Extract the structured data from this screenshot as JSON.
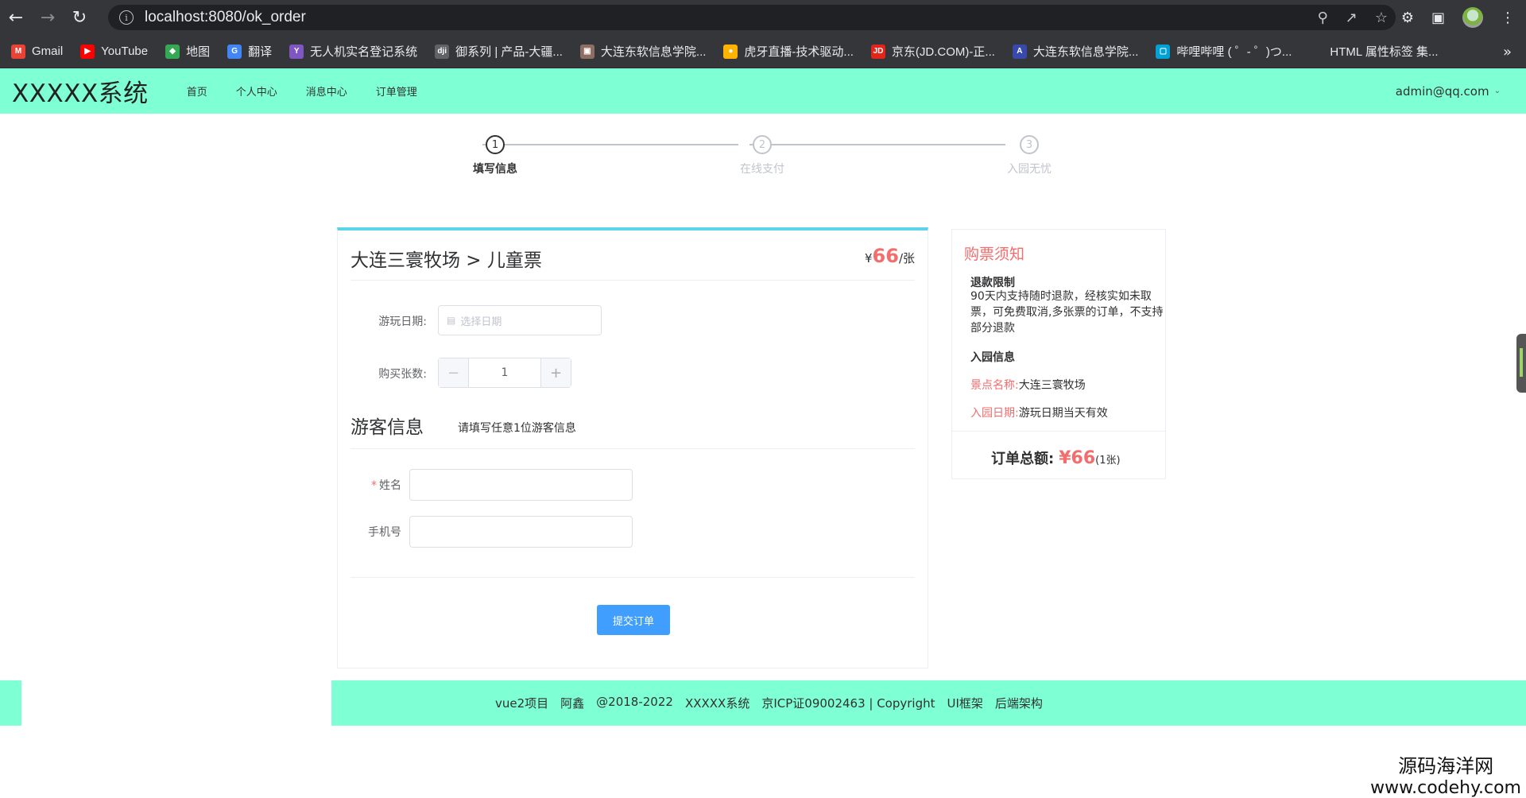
{
  "browser": {
    "url": "localhost:8080/ok_order",
    "bookmarks": [
      {
        "label": "Gmail",
        "icon": "gmail-icon",
        "color": "#ea4335",
        "glyph": "M"
      },
      {
        "label": "YouTube",
        "icon": "youtube-icon",
        "color": "#ff0000",
        "glyph": "▶"
      },
      {
        "label": "地图",
        "icon": "maps-icon",
        "color": "#34a853",
        "glyph": "◆"
      },
      {
        "label": "翻译",
        "icon": "translate-icon",
        "color": "#4285f4",
        "glyph": "G"
      },
      {
        "label": "无人机实名登记系统",
        "icon": "drone-icon",
        "color": "#7e57c2",
        "glyph": "Y"
      },
      {
        "label": "御系列 | 产品-大疆...",
        "icon": "dji-icon",
        "color": "#5f6368",
        "glyph": "dji"
      },
      {
        "label": "大连东软信息学院...",
        "icon": "school-icon",
        "color": "#8d6e63",
        "glyph": "▣"
      },
      {
        "label": "虎牙直播-技术驱动...",
        "icon": "huya-icon",
        "color": "#ffb300",
        "glyph": "●"
      },
      {
        "label": "京东(JD.COM)-正...",
        "icon": "jd-icon",
        "color": "#e1251b",
        "glyph": "JD"
      },
      {
        "label": "大连东软信息学院...",
        "icon": "school2-icon",
        "color": "#3949ab",
        "glyph": "A"
      },
      {
        "label": "哔哩哔哩 ( ゜- ゜)つ...",
        "icon": "bilibili-icon",
        "color": "#00a1d6",
        "glyph": "▢"
      },
      {
        "label": "HTML 属性标签 集...",
        "icon": "html-icon",
        "color": "#35363a",
        "glyph": ""
      }
    ],
    "more": "»"
  },
  "header": {
    "logo": "XXXXX系统",
    "menu": [
      "首页",
      "个人中心",
      "消息中心",
      "订单管理"
    ],
    "user": "admin@qq.com"
  },
  "steps": [
    {
      "num": "1",
      "label": "填写信息",
      "state": "active"
    },
    {
      "num": "2",
      "label": "在线支付",
      "state": "wait"
    },
    {
      "num": "3",
      "label": "入园无忧",
      "state": "wait"
    }
  ],
  "order": {
    "title": "大连三寰牧场 > 儿童票",
    "currency": "¥",
    "price": "66",
    "unit": "/张",
    "date_label": "游玩日期:",
    "date_placeholder": "选择日期",
    "qty_label": "购买张数:",
    "qty_value": "1",
    "qty_minus": "−",
    "qty_plus": "+",
    "visitor_title": "游客信息",
    "visitor_hint": "请填写任意1位游客信息",
    "required_mark": "*",
    "name_label": "姓名",
    "phone_label": "手机号",
    "submit_label": "提交订单"
  },
  "notice": {
    "title": "购票须知",
    "refund_head": "退款限制",
    "refund_text": "90天内支持随时退款，经核实如未取票，可免费取消,多张票的订单，不支持部分退款",
    "entry_head": "入园信息",
    "spot_key": "景点名称:",
    "spot_val": "大连三寰牧场",
    "entry_key": "入园日期:",
    "entry_val": "游玩日期当天有效",
    "total_label": "订单总额:",
    "total_amount": "¥66",
    "total_count": "(1张)"
  },
  "footer": {
    "links": [
      "vue2项目",
      "阿鑫",
      "@2018-2022",
      "XXXXX系统",
      "京ICP证09002463 | Copyright",
      "UI框架",
      "后端架构"
    ]
  },
  "watermark": {
    "line1": "源码海洋网",
    "line2": "www.codehy.com"
  }
}
